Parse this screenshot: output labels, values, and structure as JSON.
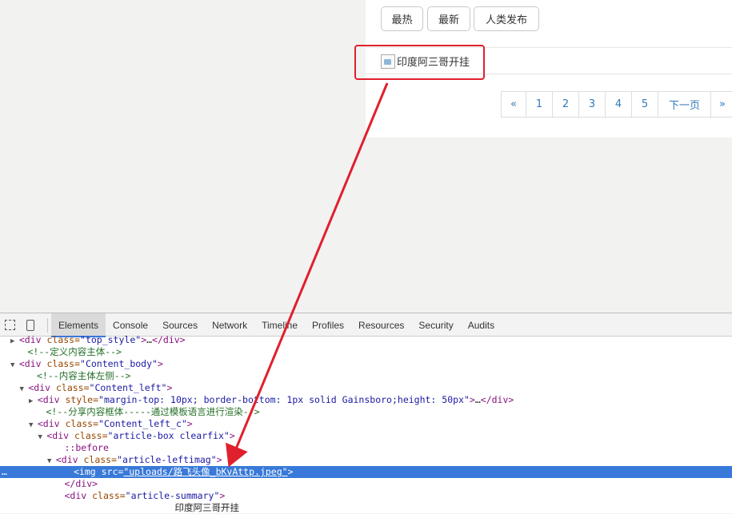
{
  "buttons": [
    "最热",
    "最新",
    "人类发布"
  ],
  "article": {
    "title": "印度阿三哥开挂",
    "img_alt": "broken image"
  },
  "pagination": [
    "«",
    "1",
    "2",
    "3",
    "4",
    "5",
    "下一页",
    "»"
  ],
  "devtools": {
    "tabs": [
      "Elements",
      "Console",
      "Sources",
      "Network",
      "Timeline",
      "Profiles",
      "Resources",
      "Security",
      "Audits"
    ],
    "active_tab": "Elements",
    "lines": [
      {
        "indent": 2,
        "tri": "▶",
        "parts": [
          [
            "tag",
            "<div "
          ],
          [
            "an",
            "class="
          ],
          [
            "av",
            "\"top_style\""
          ],
          [
            "tag",
            ">"
          ],
          [
            "txt",
            "…"
          ],
          [
            "tag",
            "</div>"
          ]
        ]
      },
      {
        "indent": 3,
        "tri": "",
        "parts": [
          [
            "cm",
            "<!--定义内容主体-->"
          ]
        ]
      },
      {
        "indent": 2,
        "tri": "▼",
        "parts": [
          [
            "tag",
            "<div "
          ],
          [
            "an",
            "class="
          ],
          [
            "av",
            "\"Content_body\""
          ],
          [
            "tag",
            ">"
          ]
        ]
      },
      {
        "indent": 4,
        "tri": "",
        "parts": [
          [
            "cm",
            "<!--内容主体左侧-->"
          ]
        ]
      },
      {
        "indent": 3,
        "tri": "▼",
        "parts": [
          [
            "tag",
            "<div "
          ],
          [
            "an",
            "class="
          ],
          [
            "av",
            "\"Content_left\""
          ],
          [
            "tag",
            ">"
          ]
        ]
      },
      {
        "indent": 4,
        "tri": "▶",
        "parts": [
          [
            "tag",
            "<div "
          ],
          [
            "an",
            "style="
          ],
          [
            "av",
            "\"margin-top: 10px; border-bottom: 1px solid Gainsboro;height: 50px\""
          ],
          [
            "tag",
            ">"
          ],
          [
            "txt",
            "…"
          ],
          [
            "tag",
            "</div>"
          ]
        ]
      },
      {
        "indent": 5,
        "tri": "",
        "parts": [
          [
            "cm",
            "<!--分享内容框体-----通过模板语言进行渲染-->"
          ]
        ]
      },
      {
        "indent": 4,
        "tri": "▼",
        "parts": [
          [
            "tag",
            "<div "
          ],
          [
            "an",
            "class="
          ],
          [
            "av",
            "\"Content_left_c\""
          ],
          [
            "tag",
            ">"
          ]
        ]
      },
      {
        "indent": 5,
        "tri": "▼",
        "parts": [
          [
            "tag",
            "<div "
          ],
          [
            "an",
            "class="
          ],
          [
            "av",
            "\"article-box clearfix\""
          ],
          [
            "tag",
            ">"
          ]
        ]
      },
      {
        "indent": 7,
        "tri": "",
        "parts": [
          [
            "pseudo",
            "::before"
          ]
        ]
      },
      {
        "indent": 6,
        "tri": "▼",
        "parts": [
          [
            "tag",
            "<div "
          ],
          [
            "an",
            "class="
          ],
          [
            "av",
            "\"article-leftimag\""
          ],
          [
            "tag",
            ">"
          ]
        ]
      },
      {
        "indent": 8,
        "tri": "",
        "sel": true,
        "parts": [
          [
            "tag",
            "<img "
          ],
          [
            "an",
            "src="
          ],
          [
            "av",
            "\"uploads/路飞头像_bKvAttp.jpeg\""
          ],
          [
            "tag",
            ">"
          ]
        ]
      },
      {
        "indent": 7,
        "tri": "",
        "parts": [
          [
            "tag",
            "</div>"
          ]
        ]
      },
      {
        "indent": 7,
        "tri": "",
        "parts": [
          [
            "tag",
            "<div "
          ],
          [
            "an",
            "class="
          ],
          [
            "av",
            "\"article-summary\""
          ],
          [
            "tag",
            ">"
          ]
        ]
      },
      {
        "indent": 19,
        "tri": "",
        "parts": [
          [
            "txt",
            "印度阿三哥开挂"
          ]
        ]
      }
    ]
  },
  "colors": {
    "annotation_red": "#e0202c",
    "selection_blue": "#3879d9",
    "link_blue": "#337ab7"
  }
}
